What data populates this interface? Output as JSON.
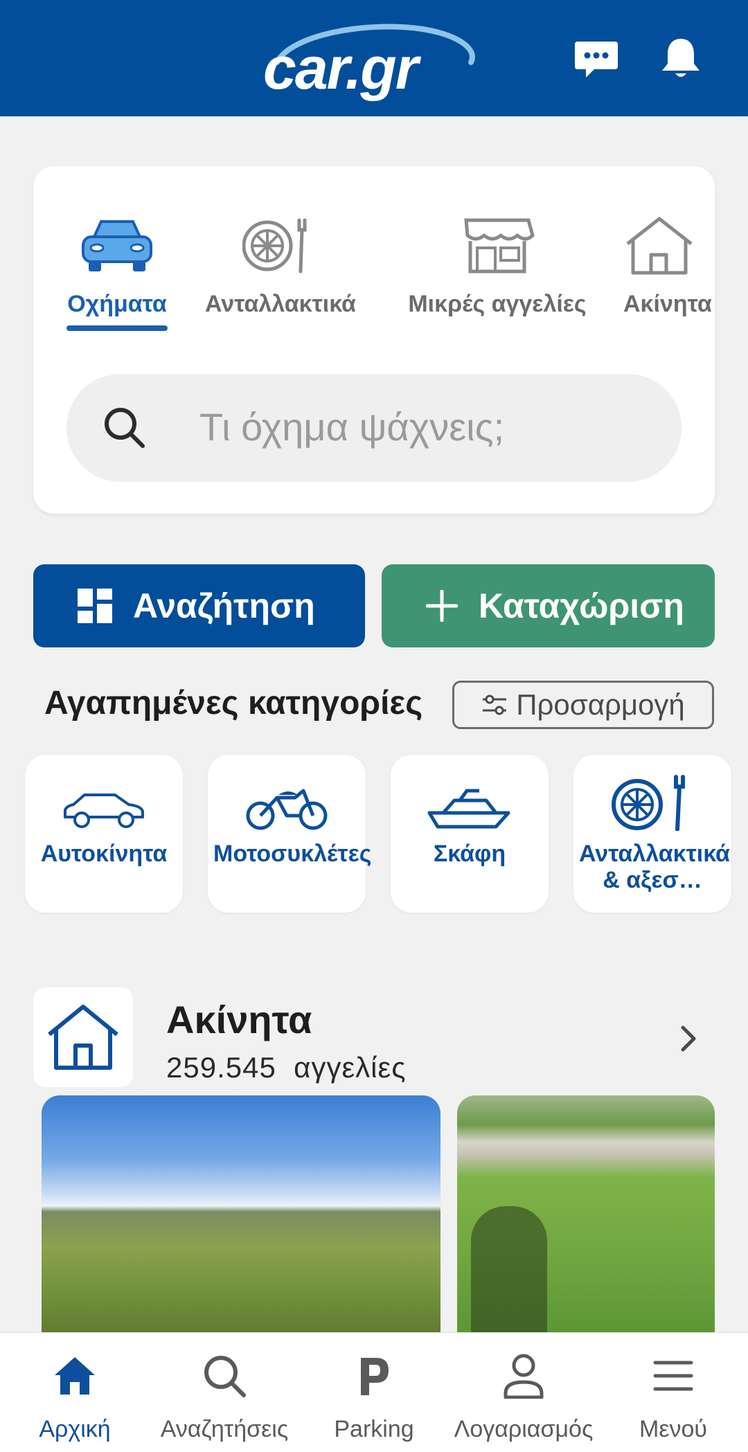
{
  "header": {
    "logo_text": "car.gr",
    "icons": [
      "chat-icon",
      "bell-icon"
    ]
  },
  "vertical_tabs": [
    {
      "label": "Οχήματα",
      "icon": "car-front-icon",
      "active": true
    },
    {
      "label": "Ανταλλακτικά",
      "icon": "wheel-wrench-icon",
      "active": false
    },
    {
      "label": "Μικρές αγγελίες",
      "icon": "shop-icon",
      "active": false
    },
    {
      "label": "Ακίνητα",
      "icon": "house-icon",
      "active": false
    }
  ],
  "search": {
    "placeholder": "Τι όχημα ψάχνεις;"
  },
  "actions": {
    "search_label": "Αναζήτηση",
    "add_label": "Καταχώριση"
  },
  "favourites": {
    "title": "Αγαπημένες κατηγορίες",
    "customize_label": "Προσαρμογή",
    "items": [
      {
        "label": "Αυτοκίνητα",
        "icon": "car-icon"
      },
      {
        "label": "Μοτοσυκλέτες",
        "icon": "motorcycle-icon"
      },
      {
        "label": "Σκάφη",
        "icon": "boat-icon"
      },
      {
        "label": "Ανταλλακτικά & αξεσ…",
        "icon": "wheel-wrench-icon"
      }
    ]
  },
  "real_estate": {
    "title": "Ακίνητα",
    "count": "259.545",
    "count_suffix": "αγγελίες"
  },
  "bottom_nav": [
    {
      "label": "Αρχική",
      "icon": "home-icon",
      "active": true
    },
    {
      "label": "Αναζητήσεις",
      "icon": "search-icon",
      "active": false
    },
    {
      "label": "Parking",
      "icon": "parking-icon",
      "active": false
    },
    {
      "label": "Λογαριασμός",
      "icon": "user-icon",
      "active": false
    },
    {
      "label": "Μενού",
      "icon": "menu-icon",
      "active": false
    }
  ],
  "colors": {
    "brand_blue": "#024e9a",
    "accent_green": "#3f9474",
    "active_blue": "#1a5fb4"
  }
}
